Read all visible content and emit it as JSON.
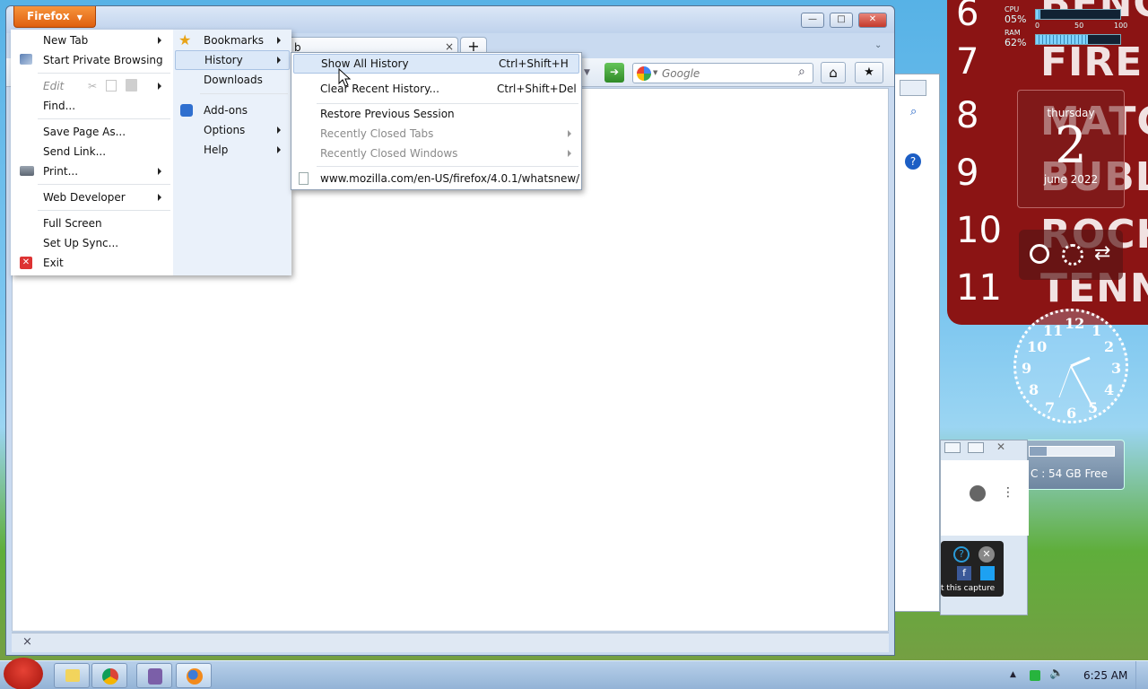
{
  "firefox_button": {
    "label": "Firefox"
  },
  "tab": {
    "title_fragment": "b",
    "close_glyph": "×",
    "new_tab_glyph": "+",
    "list_glyph": "⌄"
  },
  "window_controls": {
    "minimize": "—",
    "maximize": "□",
    "close": "✕"
  },
  "search": {
    "placeholder": "Google"
  },
  "main_menu": {
    "left": [
      {
        "label": "New Tab",
        "submenu": true
      },
      {
        "label": "Start Private Browsing"
      },
      {
        "label": "Edit",
        "submenu": true,
        "disabled": true
      },
      {
        "label": "Find..."
      },
      {
        "label": "Save Page As..."
      },
      {
        "label": "Send Link..."
      },
      {
        "label": "Print...",
        "submenu": true
      },
      {
        "label": "Web Developer",
        "submenu": true
      },
      {
        "label": "Full Screen"
      },
      {
        "label": "Set Up Sync..."
      },
      {
        "label": "Exit"
      }
    ],
    "right": [
      {
        "label": "Bookmarks",
        "submenu": true
      },
      {
        "label": "History",
        "submenu": true,
        "highlighted": true
      },
      {
        "label": "Downloads"
      },
      {
        "label": "Add-ons"
      },
      {
        "label": "Options",
        "submenu": true
      },
      {
        "label": "Help",
        "submenu": true
      }
    ]
  },
  "history_menu": {
    "items": [
      {
        "label": "Show All History",
        "shortcut": "Ctrl+Shift+H",
        "highlighted": true
      },
      {
        "label": "Clear Recent History...",
        "shortcut": "Ctrl+Shift+Del"
      },
      {
        "label": "Restore Previous Session"
      },
      {
        "label": "Recently Closed Tabs",
        "disabled": true,
        "submenu": true
      },
      {
        "label": "Recently Closed Windows",
        "disabled": true,
        "submenu": true
      },
      {
        "label": "www.mozilla.com/en-US/firefox/4.0.1/whatsnew/"
      }
    ]
  },
  "addon_bar": {
    "close_glyph": "×"
  },
  "gadgets": {
    "cpu": {
      "label": "CPU",
      "value": "05%",
      "fraction": 0.05
    },
    "ram": {
      "label": "RAM",
      "value": "62%",
      "fraction": 0.62
    },
    "scale": {
      "min": "0",
      "mid": "50",
      "max": "100"
    },
    "hours": [
      "6",
      "7",
      "8",
      "9",
      "10",
      "11"
    ],
    "words": [
      "BENC",
      "FIRE",
      "MATC",
      "BUBL",
      "ROCK",
      "TENN"
    ],
    "calendar": {
      "weekday": "thursday",
      "day": "2",
      "month_year": "june 2022"
    },
    "clock_numbers": [
      "12",
      "1",
      "2",
      "3",
      "4",
      "5",
      "6",
      "7",
      "8",
      "9",
      "10",
      "11"
    ],
    "drive": {
      "label": "C : 54 GB Free",
      "fraction": 0.2
    }
  },
  "background_window": {
    "capture_text": "t this capture"
  },
  "taskbar": {
    "time": "6:25 AM"
  },
  "colors": {
    "firefox_orange": "#e66a1a",
    "menu_highlight": "#dbe8f8",
    "gadget_red": "#8b1414"
  }
}
